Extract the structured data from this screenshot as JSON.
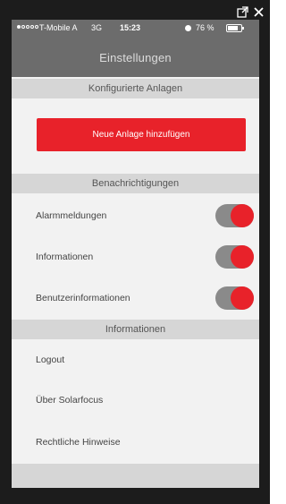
{
  "status_bar": {
    "carrier": "T-Mobile A",
    "network": "3G",
    "time": "15:23",
    "battery": "76 %",
    "battery_level": 0.76
  },
  "nav": {
    "title": "Einstellungen"
  },
  "sections": {
    "configured": "Konfigurierte Anlagen",
    "notifications": "Benachrichtigungen",
    "info": "Informationen"
  },
  "add_button": {
    "label": "Neue Anlage hinzufügen"
  },
  "toggles": [
    {
      "label": "Alarmmeldungen",
      "on": true
    },
    {
      "label": "Informationen",
      "on": true
    },
    {
      "label": "Benutzerinformationen",
      "on": true
    }
  ],
  "info_items": [
    {
      "label": "Logout"
    },
    {
      "label": "Über Solarfocus"
    },
    {
      "label": "Rechtliche Hinweise"
    }
  ],
  "colors": {
    "accent": "#e8222a",
    "header": "#6c6c6c",
    "section": "#d6d6d6"
  },
  "window_icons": [
    "external-link-icon",
    "close-icon"
  ]
}
